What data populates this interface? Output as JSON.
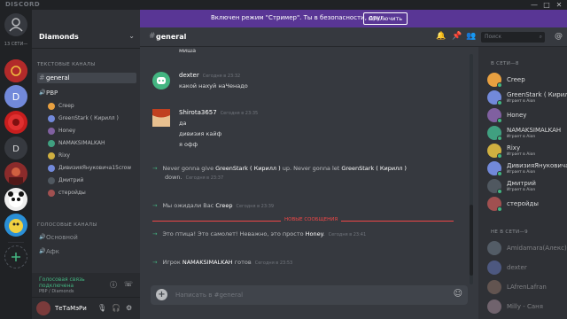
{
  "titlebar": {
    "brand": "DISCORD",
    "minimize": "—",
    "maximize": "□",
    "close": "✕"
  },
  "rail": {
    "online_label": "13 СЕТИ—"
  },
  "guild": {
    "name": "Diamonds",
    "chevron": "⌄"
  },
  "channels": {
    "text_category": "ТЕКСТОВЫЕ КАНАЛЫ",
    "text": [
      {
        "name": "general",
        "active": true
      }
    ],
    "voice_channel": "PBP",
    "voice_members": [
      "Creep",
      "GreenStark ( Кирилл )",
      "Honey",
      "NAMAKSIMALKAH",
      "Rixy",
      "ДивизияЯнуковича15crow",
      "Дмитрий",
      "стеройды"
    ],
    "voice_category": "ГОЛОСОВЫЕ КАНАЛЫ",
    "voice": [
      "Основной",
      "Афк"
    ]
  },
  "voice_status": {
    "line1": "Голосовая связь",
    "line2": "подключена",
    "sub": "PBP / Diamonds"
  },
  "user": {
    "name": "ТеТаМэРи"
  },
  "banner": {
    "text": "Включен режим \"Стример\". Ты в безопасности, друг.",
    "button": "Отключить"
  },
  "header": {
    "channel": "general",
    "search_placeholder": "Поиск"
  },
  "messages": {
    "fragment": "миша",
    "groups": [
      {
        "author": "dexter",
        "time": "Сегодня в 23:32",
        "lines": [
          "какой нахуй наЧенадо"
        ]
      },
      {
        "author": "Shirota3657",
        "time": "Сегодня в 23:35",
        "lines": [
          "да",
          "дивизия кайф",
          "я офф"
        ]
      }
    ],
    "sys1_a": "Never gonna give ",
    "sys1_b": "GreenStark ( Кирилл )",
    "sys1_c": " up. Never gonna let ",
    "sys1_d": "GreenStark ( Кирилл )",
    "sys1_e": " down.",
    "sys1_time": "Сегодня в 23:37",
    "sys2_a": "Мы ожидали Вас ",
    "sys2_b": "Creep",
    "sys2_time": "Сегодня в 23:39",
    "new_label": "НОВЫЕ СООБЩЕНИЯ",
    "sys3_a": "Это птица! Это самолет! Неважно, это просто ",
    "sys3_b": "Honey",
    "sys3_c": ".",
    "sys3_time": "Сегодня в 23:41",
    "sys4_a": "Игрок ",
    "sys4_b": "NAMAKSIMALKAH",
    "sys4_c": " готов",
    "sys4_time": "Сегодня в 23:53"
  },
  "composer": {
    "placeholder": "Написать в #general"
  },
  "members": {
    "online_header": "В СЕТИ—8",
    "online": [
      {
        "name": "Creep",
        "activity": ""
      },
      {
        "name": "GreenStark ( Кирилл )",
        "activity": "Играет в Aion"
      },
      {
        "name": "Honey",
        "activity": ""
      },
      {
        "name": "NAMAKSIMALKAH",
        "activity": "Играет в Aion"
      },
      {
        "name": "Rixy",
        "activity": "Играет в Aion"
      },
      {
        "name": "ДивизияЯнуковича15",
        "activity": "Играет в Aion"
      },
      {
        "name": "Дмитрий",
        "activity": "Играет в Aion"
      },
      {
        "name": "стеройды",
        "activity": ""
      }
    ],
    "offline_header": "НЕ В СЕТИ—9",
    "offline": [
      "Amidamara(Алекс)",
      "dexter",
      "LAfrenLafran",
      "Milly - Саня"
    ]
  },
  "colors": {
    "accent": "#7289da",
    "streamer": "#593695",
    "online": "#43b581",
    "new": "#f04747"
  }
}
